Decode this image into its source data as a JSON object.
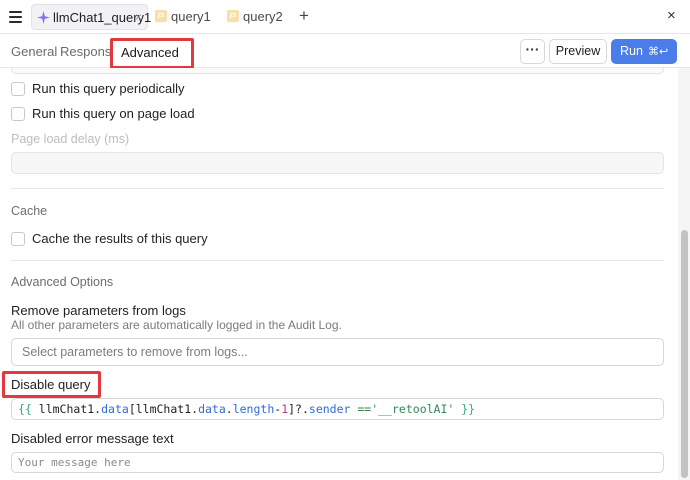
{
  "tabs": {
    "active": {
      "label": "llmChat1_query1",
      "icon": "sparkle-icon",
      "close": "×"
    },
    "others": [
      {
        "label": "query1",
        "badge": "JS"
      },
      {
        "label": "query2",
        "badge": "JS"
      }
    ],
    "add": "+",
    "close_panel": "×"
  },
  "toolbar": {
    "general": "General",
    "response": "Response",
    "advanced": "Advanced",
    "more": "···",
    "preview": "Preview",
    "run": "Run",
    "run_shortcut": "⌘↩"
  },
  "options": {
    "run_periodically": "Run this query periodically",
    "run_on_page_load": "Run this query on page load",
    "page_load_delay_label": "Page load delay (ms)"
  },
  "cache": {
    "title": "Cache",
    "cache_results": "Cache the results of this query"
  },
  "advanced_options": {
    "title": "Advanced Options",
    "remove_params_label": "Remove parameters from logs",
    "remove_params_help": "All other parameters are automatically logged in the Audit Log.",
    "remove_params_placeholder": "Select parameters to remove from logs...",
    "disable_query_label": "Disable query",
    "disable_query_code": {
      "open": "{{",
      "obj1": " llmChat1.",
      "prop1": "data",
      "bracket_open": "[llmChat1.",
      "prop2": "data",
      "dot": ".",
      "prop3": "length",
      "minus": "-",
      "num": "1",
      "bracket_close": "]?.",
      "prop4": "sender",
      "op": " ==",
      "str": "'__retoolAI'",
      "close": " }}"
    },
    "disabled_error_label": "Disabled error message text",
    "disabled_error_placeholder": "Your message here"
  },
  "colors": {
    "accent": "#4b7de8",
    "highlight": "#e0393e"
  }
}
